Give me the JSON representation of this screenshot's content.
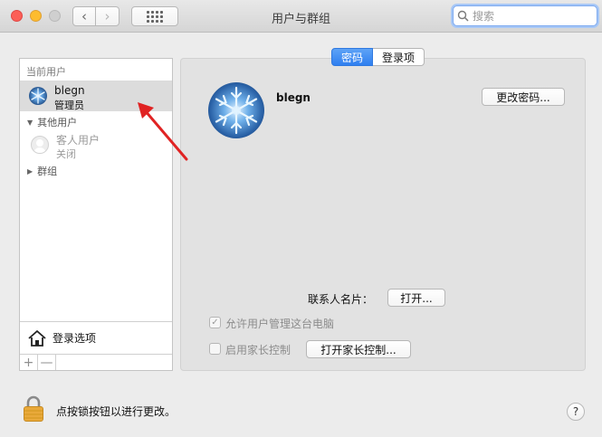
{
  "window": {
    "title": "用户与群组"
  },
  "toolbar": {
    "back_glyph": "‹",
    "forward_glyph": "›",
    "search_placeholder": "搜索"
  },
  "sidebar": {
    "current_users_header": "当前用户",
    "current_user": {
      "name": "blegn",
      "role": "管理员"
    },
    "other_users_header": "其他用户",
    "guest": {
      "name": "客人用户",
      "status": "关闭"
    },
    "groups_header": "群组",
    "login_options_label": "登录选项",
    "add_glyph": "+",
    "remove_glyph": "—"
  },
  "tabs": [
    {
      "label": "密码",
      "active": true
    },
    {
      "label": "登录项",
      "active": false
    }
  ],
  "main": {
    "user_name": "blegn",
    "change_password_button": "更改密码...",
    "contact_card_label": "联系人名片：",
    "open_button": "打开...",
    "allow_admin": {
      "label": "允许用户管理这台电脑",
      "checked": true
    },
    "parental_controls": {
      "label": "启用家长控制",
      "checked": false
    },
    "open_parental_button": "打开家长控制..."
  },
  "footer": {
    "lock_text": "点按锁按钮以进行更改。",
    "help_glyph": "?"
  },
  "colors": {
    "accent": "#2f7ff0",
    "arrow": "#e02323",
    "selection": "#dcdcdc"
  }
}
